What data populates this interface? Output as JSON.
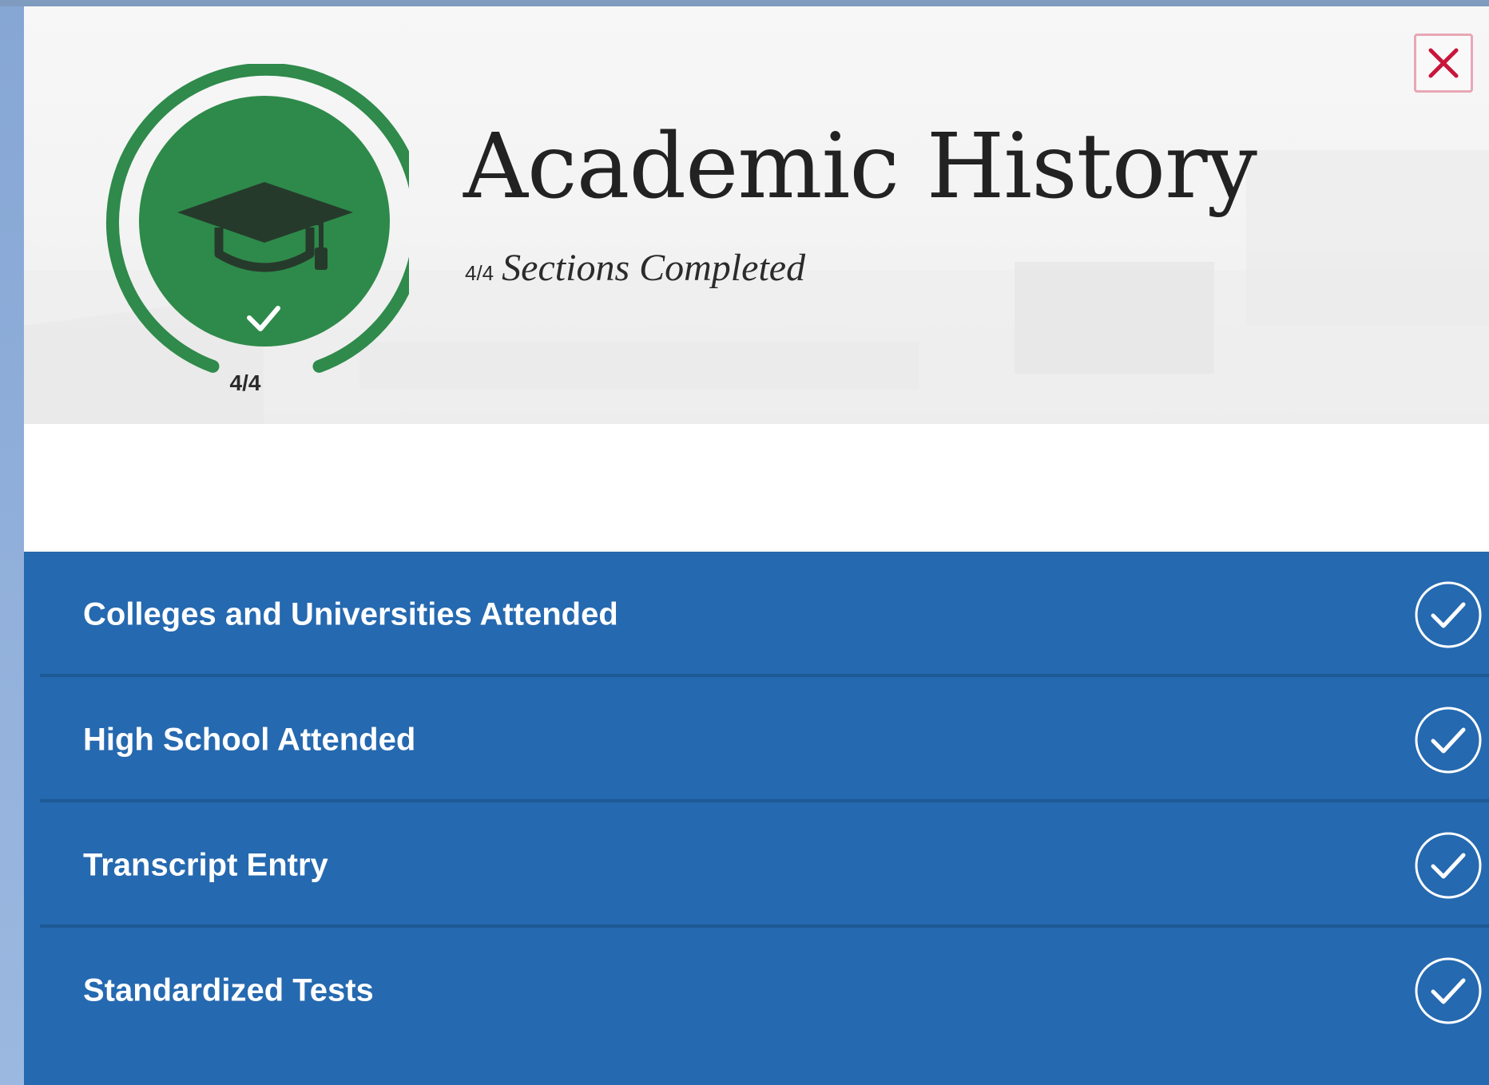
{
  "modal": {
    "close_label": "Close",
    "icons": {
      "close": "close-icon",
      "cap": "graduation-cap-icon",
      "check": "checkmark-icon"
    },
    "colors": {
      "accent_green": "#2e8a4a",
      "ring_green": "#2f8a4b",
      "section_blue": "#2569b0",
      "close_red": "#c8153c"
    }
  },
  "progress": {
    "completed": 4,
    "total": 4,
    "label": "4/4"
  },
  "header": {
    "title": "Academic History",
    "fraction": "4/4",
    "subtitle": "Sections Completed"
  },
  "sections": [
    {
      "label": "Colleges and Universities Attended",
      "status": "completed"
    },
    {
      "label": "High School Attended",
      "status": "completed"
    },
    {
      "label": "Transcript Entry",
      "status": "completed"
    },
    {
      "label": "Standardized Tests",
      "status": "completed"
    }
  ]
}
